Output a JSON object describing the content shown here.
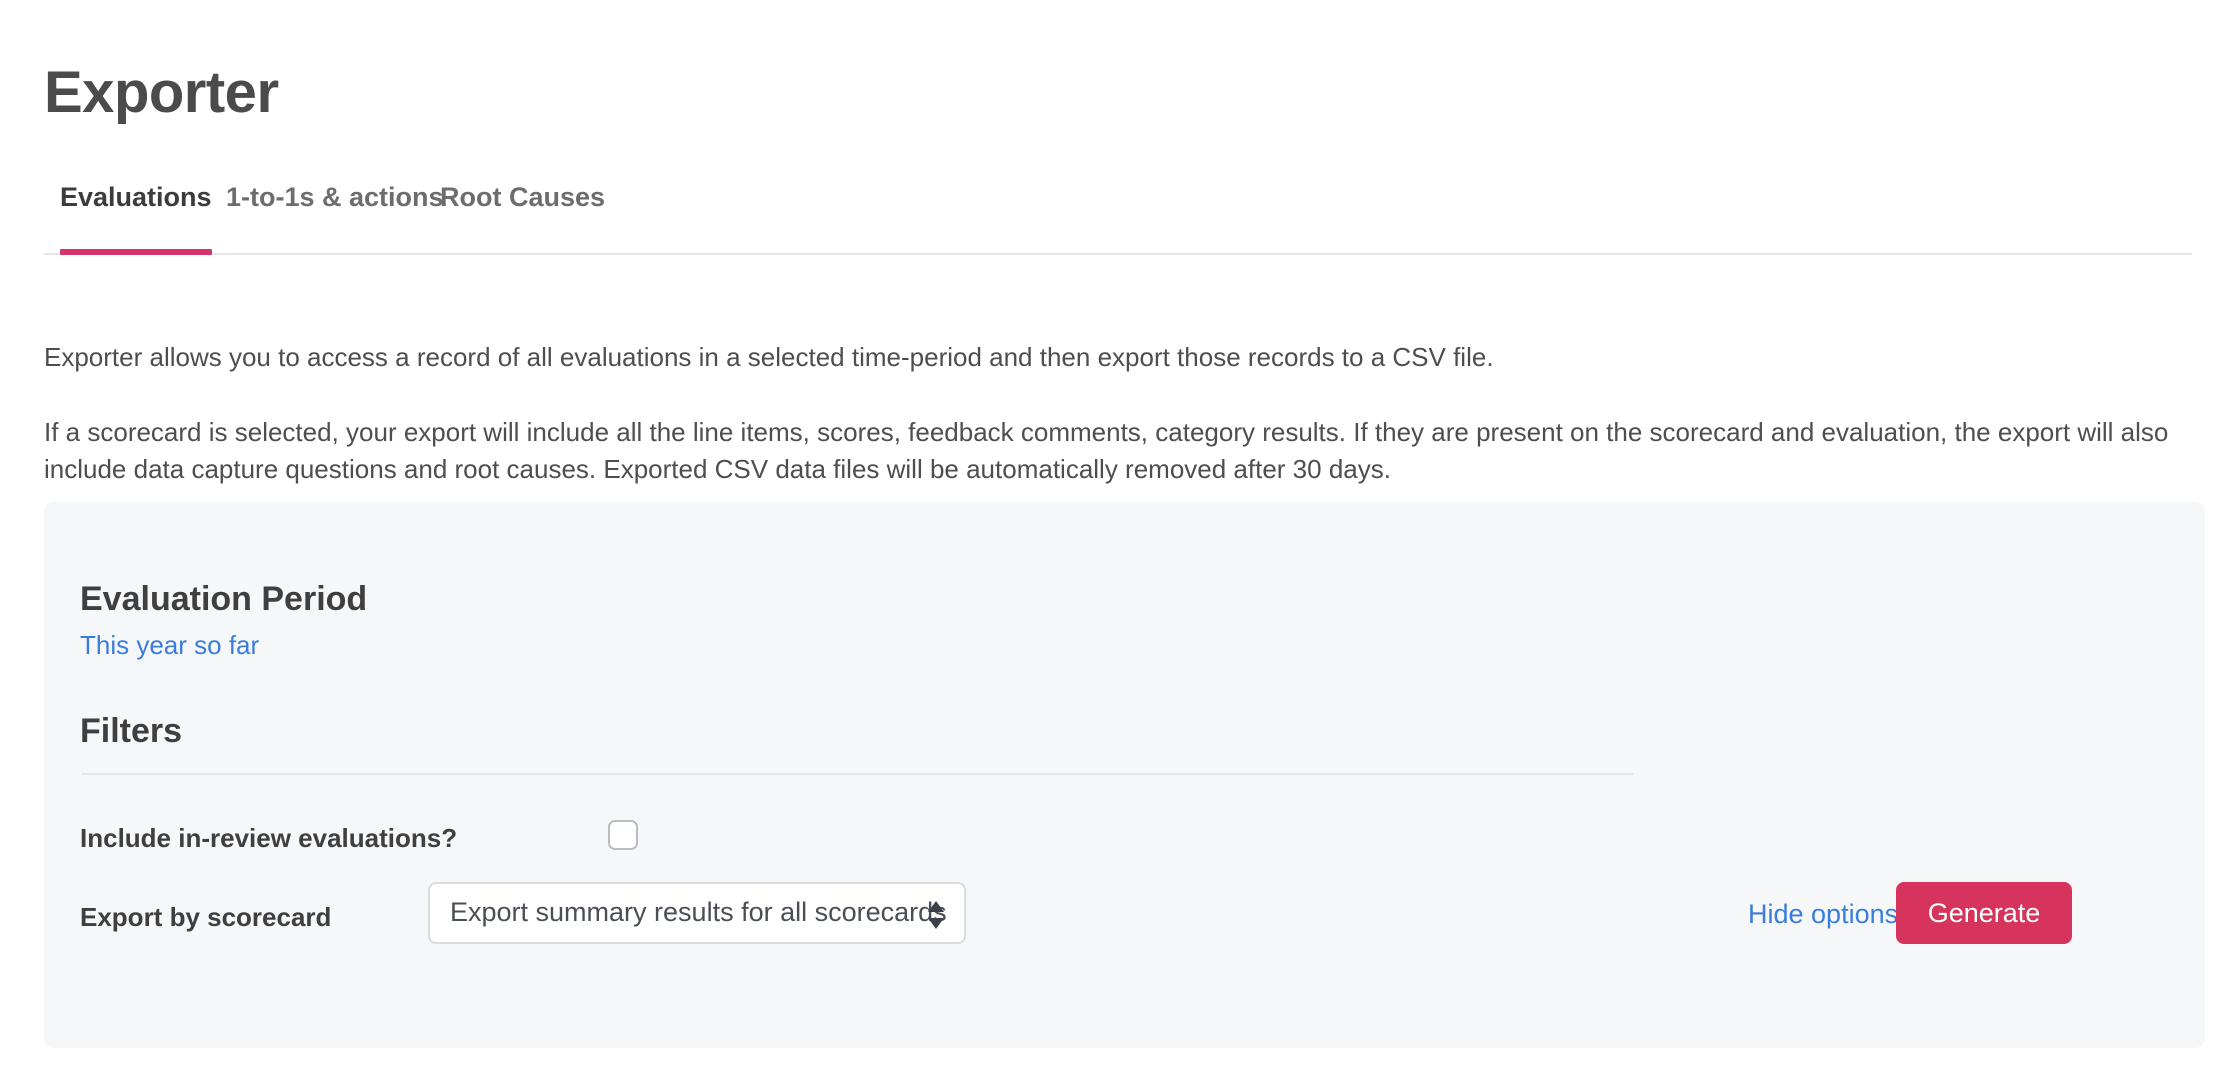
{
  "page": {
    "title": "Exporter"
  },
  "tabs": {
    "items": [
      {
        "label": "Evaluations",
        "active": true
      },
      {
        "label": "1-to-1s & actions",
        "active": false
      },
      {
        "label": "Root Causes",
        "active": false
      }
    ],
    "active_indicator_color": "#d6356b"
  },
  "intro": {
    "paragraph_1": "Exporter allows you to access a record of all evaluations in a selected time-period and then export those records to a CSV file.",
    "paragraph_2": "If a scorecard is selected, your export will include all the line items, scores, feedback comments, category results. If they are present on the scorecard and evaluation, the export will also include data capture questions and root causes. Exported CSV data files will be automatically removed after 30 days."
  },
  "card": {
    "evaluation_period_heading": "Evaluation Period",
    "evaluation_period_value": "This year so far",
    "filters_heading": "Filters",
    "filters": {
      "include_in_review": {
        "label": "Include in-review evaluations?",
        "checked": false
      },
      "export_by_scorecard": {
        "label": "Export by scorecard",
        "selected_option": "Export summary results for all scorecards"
      }
    },
    "actions": {
      "hide_options_label": "Hide options",
      "generate_label": "Generate",
      "generate_color": "#d6335d",
      "link_color": "#3b7ddd"
    }
  }
}
